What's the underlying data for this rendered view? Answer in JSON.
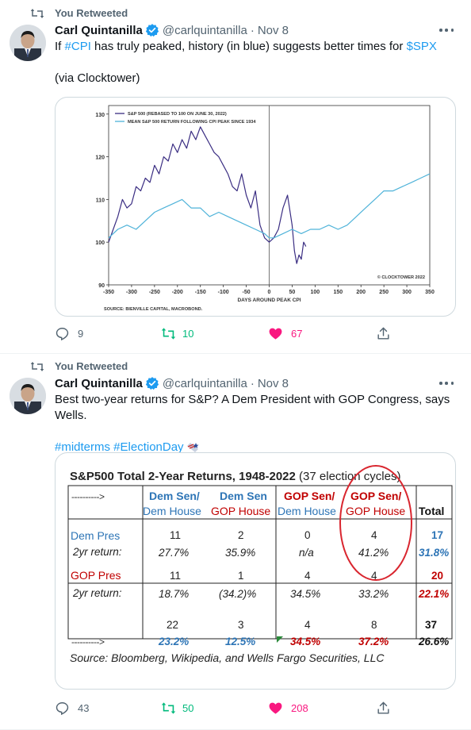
{
  "tweets": [
    {
      "retweet_label": "You Retweeted",
      "author": {
        "name": "Carl Quintanilla",
        "handle": "@carlquintanilla",
        "sep": "·",
        "date": "Nov 8"
      },
      "text": {
        "part1": "If ",
        "hashtag": "#CPI",
        "part2": " has truly peaked, history (in blue) suggests better times for ",
        "cashtag": "$SPX",
        "line2": "(via Clocktower)"
      },
      "stats": {
        "replies": "9",
        "retweets": "10",
        "likes": "67"
      }
    },
    {
      "retweet_label": "You Retweeted",
      "author": {
        "name": "Carl Quintanilla",
        "handle": "@carlquintanilla",
        "sep": "·",
        "date": "Nov 8"
      },
      "text": {
        "line1": "Best two-year returns for S&P? A Dem President with GOP Congress, says Wells.",
        "hashtags": "#midterms #ElectionDay"
      },
      "stats": {
        "replies": "43",
        "retweets": "50",
        "likes": "208"
      }
    }
  ],
  "chart_data": {
    "type": "line",
    "legend": [
      "S&P 500 (REBASED TO 100 ON JUNE 30, 2022)",
      "MEAN S&P 500 RETURN FOLLOWING CPI PEAK SINCE 1934"
    ],
    "legend_placement": "top-left",
    "xlabel": "DAYS AROUND PEAK CPI",
    "source": "SOURCE: BIENVILLE CAPITAL, MACROBOND.",
    "watermark": "© CLOCKTOWER 2022",
    "xticks": [
      -350,
      -300,
      -250,
      -200,
      -150,
      -100,
      -50,
      0,
      50,
      100,
      150,
      200,
      250,
      300,
      350
    ],
    "yticks": [
      90,
      100,
      110,
      120,
      130
    ],
    "xlim": [
      -350,
      350
    ],
    "ylim": [
      90,
      132
    ],
    "peak_line_x": 0,
    "series": [
      {
        "name": "S&P 500 (REBASED TO 100 ON JUNE 30, 2022)",
        "color": "#3a2d82",
        "x": [
          -350,
          -340,
          -330,
          -320,
          -310,
          -300,
          -290,
          -280,
          -270,
          -260,
          -250,
          -240,
          -230,
          -220,
          -210,
          -200,
          -190,
          -180,
          -170,
          -160,
          -150,
          -140,
          -130,
          -120,
          -110,
          -100,
          -90,
          -80,
          -70,
          -60,
          -50,
          -40,
          -30,
          -20,
          -10,
          0,
          10,
          20,
          30,
          40,
          50,
          55,
          60,
          65,
          70,
          75,
          80
        ],
        "values": [
          100,
          103,
          106,
          110,
          108,
          109,
          113,
          112,
          115,
          114,
          118,
          116,
          120,
          119,
          123,
          121,
          124,
          122,
          126,
          124,
          127,
          125,
          123,
          121,
          120,
          118,
          116,
          113,
          112,
          116,
          111,
          108,
          112,
          104,
          101,
          100,
          101,
          103,
          108,
          111,
          104,
          98,
          95,
          97,
          96,
          100,
          99
        ]
      },
      {
        "name": "MEAN S&P 500 RETURN FOLLOWING CPI PEAK SINCE 1934",
        "color": "#4fb3d9",
        "x": [
          -350,
          -330,
          -310,
          -290,
          -270,
          -250,
          -230,
          -210,
          -190,
          -170,
          -150,
          -130,
          -110,
          -90,
          -70,
          -50,
          -30,
          -10,
          0,
          10,
          30,
          50,
          70,
          90,
          110,
          130,
          150,
          170,
          190,
          210,
          230,
          250,
          270,
          290,
          310,
          330,
          350
        ],
        "values": [
          101,
          103,
          104,
          103,
          105,
          107,
          108,
          109,
          110,
          108,
          108,
          106,
          107,
          106,
          105,
          104,
          103,
          102,
          101,
          101,
          102,
          103,
          102,
          103,
          103,
          104,
          103,
          104,
          106,
          108,
          110,
          112,
          112,
          113,
          114,
          115,
          116
        ]
      }
    ]
  },
  "table": {
    "title": "S&P500 Total 2-Year Returns, 1948-2022",
    "title_note": "(37 election cycles)",
    "arrow": "---------->",
    "col_heads": [
      {
        "top": "Dem Sen/",
        "bottom": "Dem House"
      },
      {
        "top": "Dem Sen",
        "bottom": "GOP House"
      },
      {
        "top": "GOP Sen/",
        "bottom": "Dem House"
      },
      {
        "top": "GOP Sen/",
        "bottom": "GOP House"
      }
    ],
    "total_head": "Total",
    "rows": [
      {
        "label": "Dem Pres",
        "sub": "2yr return:",
        "counts": [
          "11",
          "2",
          "0",
          "4"
        ],
        "returns": [
          "27.7%",
          "35.9%",
          "n/a",
          "41.2%"
        ],
        "total_count": "17",
        "total_return": "31.8%"
      },
      {
        "label": "GOP Pres",
        "sub": "2yr return:",
        "counts": [
          "11",
          "1",
          "4",
          "4"
        ],
        "returns": [
          "18.7%",
          "(34.2)%",
          "34.5%",
          "33.2%"
        ],
        "total_count": "20",
        "total_return": "22.1%"
      }
    ],
    "totals": {
      "counts": [
        "22",
        "3",
        "4",
        "8"
      ],
      "returns": [
        "23.2%",
        "12.5%",
        "34.5%",
        "37.2%"
      ],
      "total_count": "37",
      "total_return": "26.6%"
    },
    "source": "Source: Bloomberg, Wikipedia, and Wells Fargo Securities, LLC",
    "colors": {
      "dem": "#2e75b6",
      "gop": "#c00000",
      "highlight": "#d9262f"
    }
  }
}
